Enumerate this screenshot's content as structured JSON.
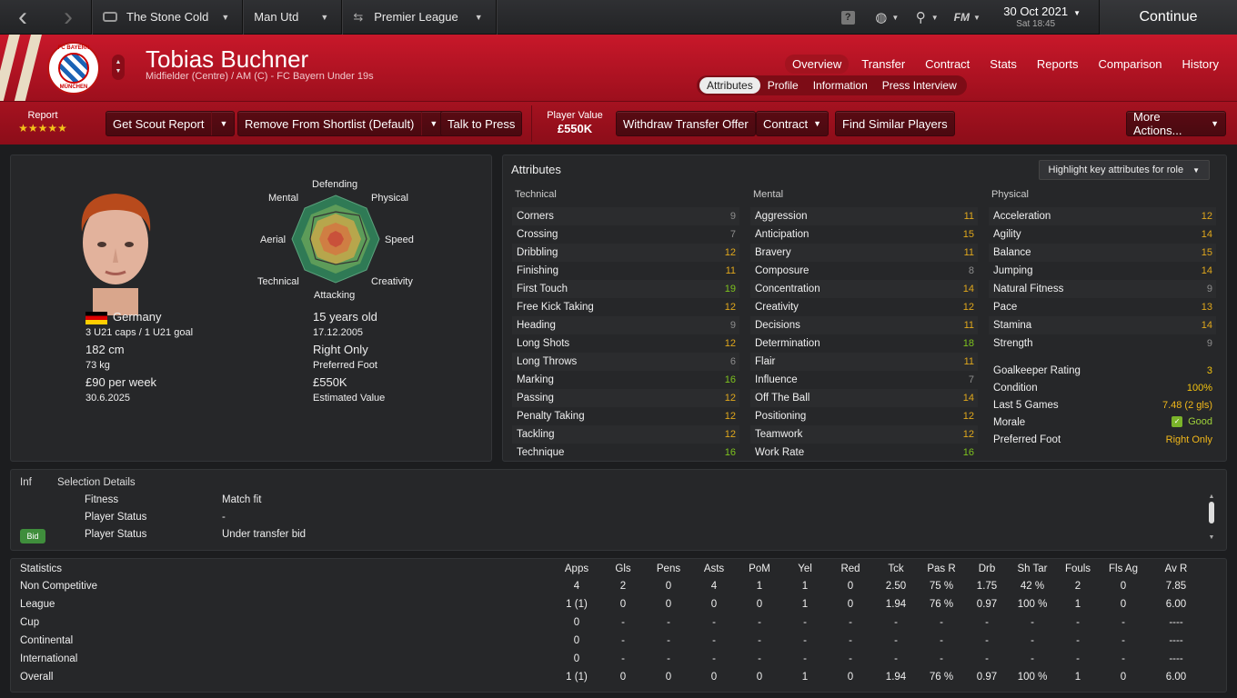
{
  "topbar": {
    "back_icon": "chevron-left-icon",
    "forward_icon": "chevron-right-icon",
    "manager": "The Stone Cold",
    "club": "Man Utd",
    "competition": "Premier League",
    "date": "30 Oct 2021",
    "day_time": "Sat 18:45",
    "continue_label": "Continue"
  },
  "header": {
    "player_name": "Tobias Buchner",
    "subtitle": "Midfielder (Centre) / AM (C) - FC Bayern Under 19s",
    "crest_top": "FC BAYERN",
    "crest_bottom": "MÜNCHEN",
    "main_tabs": [
      "Overview",
      "Transfer",
      "Contract",
      "Stats",
      "Reports",
      "Comparison",
      "History"
    ],
    "sub_tabs": [
      "Attributes",
      "Profile",
      "Information",
      "Press Interview"
    ]
  },
  "actions": {
    "report_label": "Report",
    "stars": "★★★★★",
    "scout_report": "Get Scout Report",
    "remove_shortlist": "Remove From Shortlist (Default)",
    "talk_press": "Talk to Press",
    "value_label": "Player Value",
    "value": "£550K",
    "withdraw": "Withdraw Transfer Offer",
    "contract": "Contract",
    "similar": "Find Similar Players",
    "more": "More Actions..."
  },
  "profile": {
    "nation": "Germany",
    "caps": "3 U21 caps / 1 U21 goal",
    "height": "182 cm",
    "weight": "73 kg",
    "wage": "£90 per week",
    "contract_end": "30.6.2025",
    "age": "15 years old",
    "dob": "17.12.2005",
    "foot": "Right Only",
    "foot_label": "Preferred Foot",
    "est_value": "£550K",
    "est_value_label": "Estimated Value",
    "radar_labels": [
      "Defending",
      "Physical",
      "Speed",
      "Creativity",
      "Attacking",
      "Technical",
      "Aerial",
      "Mental"
    ]
  },
  "attributes": {
    "title": "Attributes",
    "highlight": "Highlight key attributes for role",
    "technical_title": "Technical",
    "mental_title": "Mental",
    "physical_title": "Physical",
    "technical": [
      {
        "name": "Corners",
        "value": "9"
      },
      {
        "name": "Crossing",
        "value": "7"
      },
      {
        "name": "Dribbling",
        "value": "12"
      },
      {
        "name": "Finishing",
        "value": "11"
      },
      {
        "name": "First Touch",
        "value": "19"
      },
      {
        "name": "Free Kick Taking",
        "value": "12"
      },
      {
        "name": "Heading",
        "value": "9"
      },
      {
        "name": "Long Shots",
        "value": "12"
      },
      {
        "name": "Long Throws",
        "value": "6"
      },
      {
        "name": "Marking",
        "value": "16"
      },
      {
        "name": "Passing",
        "value": "12"
      },
      {
        "name": "Penalty Taking",
        "value": "12"
      },
      {
        "name": "Tackling",
        "value": "12"
      },
      {
        "name": "Technique",
        "value": "16"
      }
    ],
    "mental": [
      {
        "name": "Aggression",
        "value": "11"
      },
      {
        "name": "Anticipation",
        "value": "15"
      },
      {
        "name": "Bravery",
        "value": "11"
      },
      {
        "name": "Composure",
        "value": "8"
      },
      {
        "name": "Concentration",
        "value": "14"
      },
      {
        "name": "Creativity",
        "value": "12"
      },
      {
        "name": "Decisions",
        "value": "11"
      },
      {
        "name": "Determination",
        "value": "18"
      },
      {
        "name": "Flair",
        "value": "11"
      },
      {
        "name": "Influence",
        "value": "7"
      },
      {
        "name": "Off The Ball",
        "value": "14"
      },
      {
        "name": "Positioning",
        "value": "12"
      },
      {
        "name": "Teamwork",
        "value": "12"
      },
      {
        "name": "Work Rate",
        "value": "16"
      }
    ],
    "physical": [
      {
        "name": "Acceleration",
        "value": "12"
      },
      {
        "name": "Agility",
        "value": "14"
      },
      {
        "name": "Balance",
        "value": "15"
      },
      {
        "name": "Jumping",
        "value": "14"
      },
      {
        "name": "Natural Fitness",
        "value": "9"
      },
      {
        "name": "Pace",
        "value": "13"
      },
      {
        "name": "Stamina",
        "value": "14"
      },
      {
        "name": "Strength",
        "value": "9"
      }
    ],
    "extra": [
      {
        "name": "Goalkeeper Rating",
        "value": "3"
      },
      {
        "name": "Condition",
        "value": "100%"
      },
      {
        "name": "Last 5 Games",
        "value": "7.48 (2 gls)"
      },
      {
        "name": "Morale",
        "value": "Good"
      },
      {
        "name": "Preferred Foot",
        "value": "Right Only"
      }
    ]
  },
  "selection": {
    "inf_header": "Inf",
    "title": "Selection Details",
    "bid_badge": "Bid",
    "rows": [
      {
        "label": "Fitness",
        "value": "Match fit"
      },
      {
        "label": "Player Status",
        "value": "-"
      },
      {
        "label": "Player Status",
        "value": "Under transfer bid"
      }
    ]
  },
  "statistics": {
    "title": "Statistics",
    "columns": [
      "Apps",
      "Gls",
      "Pens",
      "Asts",
      "PoM",
      "Yel",
      "Red",
      "Tck",
      "Pas R",
      "Drb",
      "Sh Tar",
      "Fouls",
      "Fls Ag",
      "Av R"
    ],
    "rows": [
      {
        "name": "Non Competitive",
        "values": [
          "4",
          "2",
          "0",
          "4",
          "1",
          "1",
          "0",
          "2.50",
          "75 %",
          "1.75",
          "42 %",
          "2",
          "0",
          "7.85"
        ]
      },
      {
        "name": "League",
        "values": [
          "1 (1)",
          "0",
          "0",
          "0",
          "0",
          "1",
          "0",
          "1.94",
          "76 %",
          "0.97",
          "100 %",
          "1",
          "0",
          "6.00"
        ]
      },
      {
        "name": "Cup",
        "values": [
          "0",
          "-",
          "-",
          "-",
          "-",
          "-",
          "-",
          "-",
          "-",
          "-",
          "-",
          "-",
          "-",
          "----"
        ]
      },
      {
        "name": "Continental",
        "values": [
          "0",
          "-",
          "-",
          "-",
          "-",
          "-",
          "-",
          "-",
          "-",
          "-",
          "-",
          "-",
          "-",
          "----"
        ]
      },
      {
        "name": "International",
        "values": [
          "0",
          "-",
          "-",
          "-",
          "-",
          "-",
          "-",
          "-",
          "-",
          "-",
          "-",
          "-",
          "-",
          "----"
        ]
      },
      {
        "name": "Overall",
        "values": [
          "1 (1)",
          "0",
          "0",
          "0",
          "0",
          "1",
          "0",
          "1.94",
          "76 %",
          "0.97",
          "100 %",
          "1",
          "0",
          "6.00"
        ]
      }
    ]
  }
}
